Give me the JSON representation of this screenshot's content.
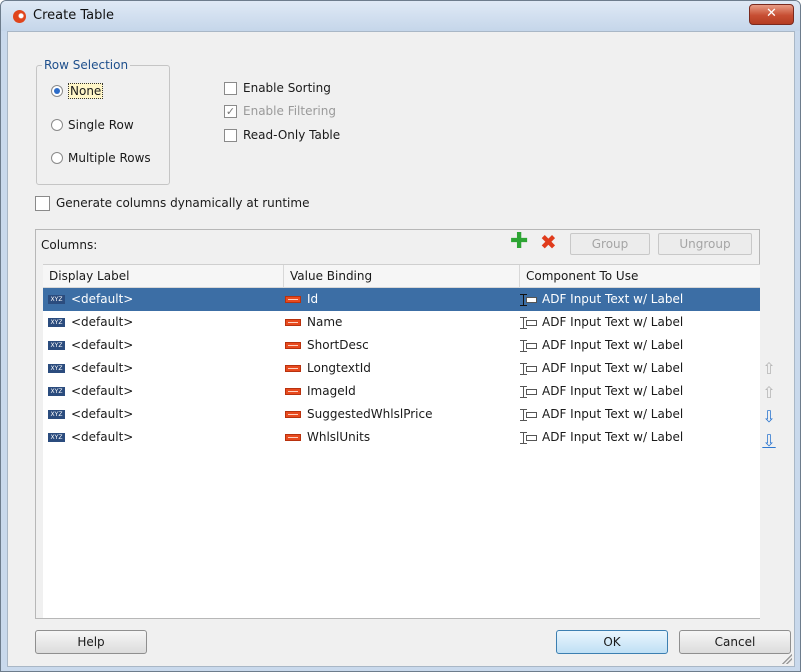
{
  "window": {
    "title": "Create Table",
    "close_glyph": "✕"
  },
  "row_selection": {
    "legend": "Row Selection",
    "options": [
      {
        "label": "None",
        "selected": true
      },
      {
        "label": "Single Row",
        "selected": false
      },
      {
        "label": "Multiple Rows",
        "selected": false
      }
    ]
  },
  "options": {
    "enable_sorting": {
      "label": "Enable Sorting",
      "checked": false,
      "enabled": true
    },
    "enable_filtering": {
      "label": "Enable Filtering",
      "checked": true,
      "enabled": false
    },
    "read_only": {
      "label": "Read-Only Table",
      "checked": false,
      "enabled": true
    }
  },
  "generate_columns": {
    "label": "Generate columns dynamically at runtime",
    "checked": false
  },
  "columns_panel": {
    "label": "Columns:",
    "add_icon": "plus-icon",
    "delete_icon": "delete-icon",
    "group_label": "Group",
    "ungroup_label": "Ungroup",
    "headers": [
      "Display Label",
      "Value Binding",
      "Component To Use"
    ],
    "rows": [
      {
        "display": "<default>",
        "binding": "Id",
        "component": "ADF Input Text w/ Label",
        "selected": true
      },
      {
        "display": "<default>",
        "binding": "Name",
        "component": "ADF Input Text w/ Label",
        "selected": false
      },
      {
        "display": "<default>",
        "binding": "ShortDesc",
        "component": "ADF Input Text w/ Label",
        "selected": false
      },
      {
        "display": "<default>",
        "binding": "LongtextId",
        "component": "ADF Input Text w/ Label",
        "selected": false
      },
      {
        "display": "<default>",
        "binding": "ImageId",
        "component": "ADF Input Text w/ Label",
        "selected": false
      },
      {
        "display": "<default>",
        "binding": "SuggestedWhlslPrice",
        "component": "ADF Input Text w/ Label",
        "selected": false
      },
      {
        "display": "<default>",
        "binding": "WhlslUnits",
        "component": "ADF Input Text w/ Label",
        "selected": false
      }
    ],
    "icon_text": "XYZ"
  },
  "reorder": {
    "move_top": "⇧",
    "move_up": "⇧",
    "move_down": "⇩",
    "move_bottom": "⇩"
  },
  "footer": {
    "help_label": "Help",
    "ok_label": "OK",
    "cancel_label": "Cancel"
  },
  "colors": {
    "selection": "#3c6ea5",
    "accent": "#2d6cc8",
    "disabled_text": "#9a9a9a"
  }
}
